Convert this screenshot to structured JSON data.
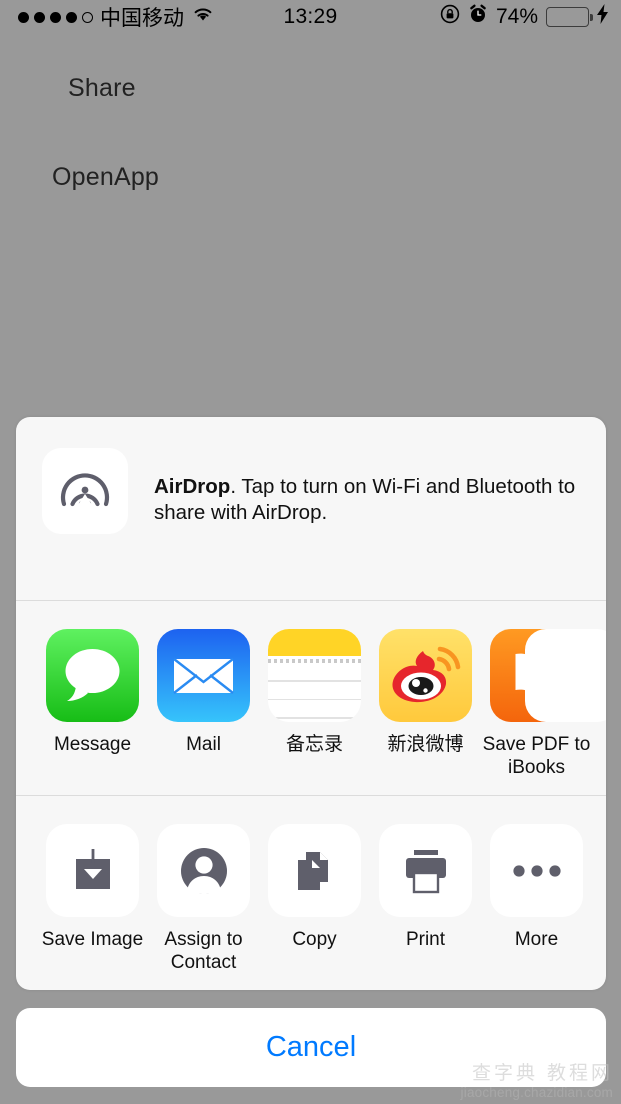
{
  "status_bar": {
    "signal_dots_filled": 4,
    "signal_dots_total": 5,
    "carrier": "中国移动",
    "wifi_icon": "wifi-icon",
    "time": "13:29",
    "rotation_lock_icon": "rotation-lock-icon",
    "alarm_icon": "alarm-clock-icon",
    "battery_percent": "74%",
    "battery_level": 74,
    "battery_color": "#4cd964",
    "charging_icon": "lightning-bolt-icon"
  },
  "background": {
    "share_label": "Share",
    "openapp_label": "OpenApp"
  },
  "share_sheet": {
    "airdrop": {
      "icon": "airdrop-icon",
      "title": "AirDrop",
      "message": ". Tap to turn on Wi-Fi and Bluetooth to share with AirDrop."
    },
    "apps": [
      {
        "label": "Message",
        "icon": "message-icon"
      },
      {
        "label": "Mail",
        "icon": "mail-icon"
      },
      {
        "label": "备忘录",
        "icon": "notes-icon"
      },
      {
        "label": "新浪微博",
        "icon": "weibo-icon"
      },
      {
        "label": "Save PDF to iBooks",
        "icon": "ibooks-icon"
      }
    ],
    "actions": [
      {
        "label": "Save Image",
        "icon": "save-image-icon"
      },
      {
        "label": "Assign to Contact",
        "icon": "contact-person-icon"
      },
      {
        "label": "Copy",
        "icon": "copy-documents-icon"
      },
      {
        "label": "Print",
        "icon": "printer-icon"
      },
      {
        "label": "More",
        "icon": "more-ellipsis-icon"
      }
    ],
    "cancel_label": "Cancel",
    "accent_color": "#007aff"
  },
  "watermark": {
    "text_cn": "查字典 教程网",
    "url": "jiaocheng.chazidian.com"
  }
}
